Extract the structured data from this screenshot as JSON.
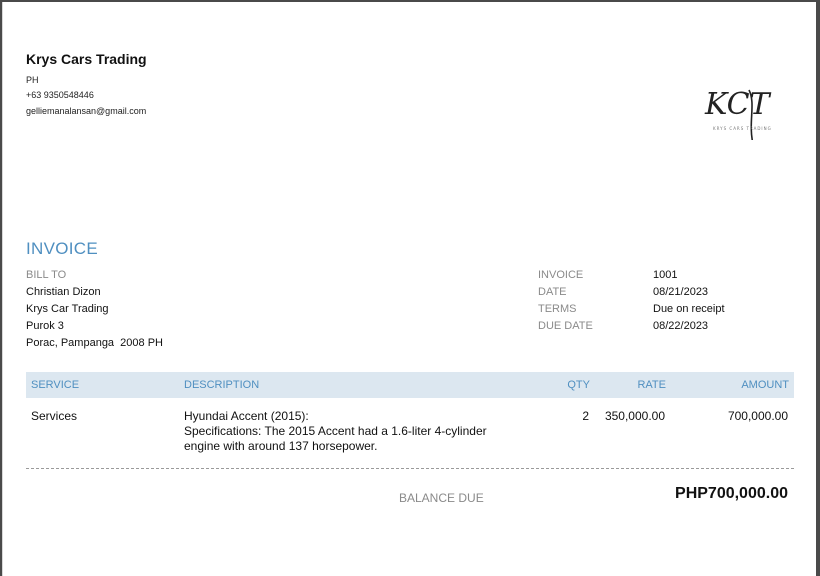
{
  "company": {
    "name": "Krys Cars Trading",
    "country": "PH",
    "phone": "+63 9350548446",
    "email": "gelliemanalansan@gmail.com",
    "logo_text": "KCT",
    "logo_subtext": "KRYS CARS TRADING"
  },
  "title": "INVOICE",
  "bill_to": {
    "label": "BILL TO",
    "name": "Christian Dizon",
    "company": "Krys Car Trading",
    "address1": "Purok 3",
    "address2": "Porac, Pampanga  2008 PH"
  },
  "meta": {
    "invoice_label": "INVOICE",
    "invoice_value": "1001",
    "date_label": "DATE",
    "date_value": "08/21/2023",
    "terms_label": "TERMS",
    "terms_value": "Due on receipt",
    "due_label": "DUE DATE",
    "due_value": "08/22/2023"
  },
  "table": {
    "headers": {
      "service": "SERVICE",
      "description": "DESCRIPTION",
      "qty": "QTY",
      "rate": "RATE",
      "amount": "AMOUNT"
    },
    "rows": [
      {
        "service": "Services",
        "description_lines": [
          "Hyundai Accent (2015):",
          "Specifications: The 2015 Accent had a 1.6-liter 4-cylinder",
          "engine with around 137 horsepower."
        ],
        "qty": "2",
        "rate": "350,000.00",
        "amount": "700,000.00"
      }
    ]
  },
  "balance": {
    "label": "BALANCE DUE",
    "value": "PHP700,000.00"
  }
}
